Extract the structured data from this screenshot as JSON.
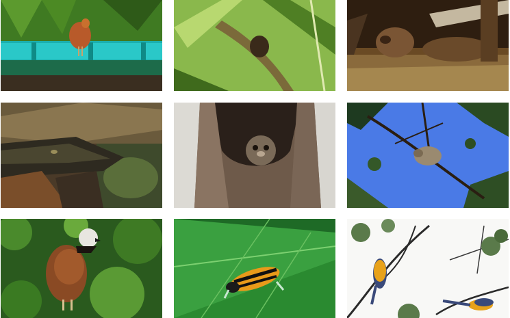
{
  "gallery": {
    "photos": [
      {
        "subject": "heron-on-canoe"
      },
      {
        "subject": "monkey-in-foliage"
      },
      {
        "subject": "giant-otter-in-water"
      },
      {
        "subject": "caiman-close-up"
      },
      {
        "subject": "owl-monkey-in-tree-hollow"
      },
      {
        "subject": "sloth-in-branches"
      },
      {
        "subject": "black-collared-hawk"
      },
      {
        "subject": "poison-dart-frog-on-leaf"
      },
      {
        "subject": "macaws-on-bare-branches"
      }
    ]
  }
}
